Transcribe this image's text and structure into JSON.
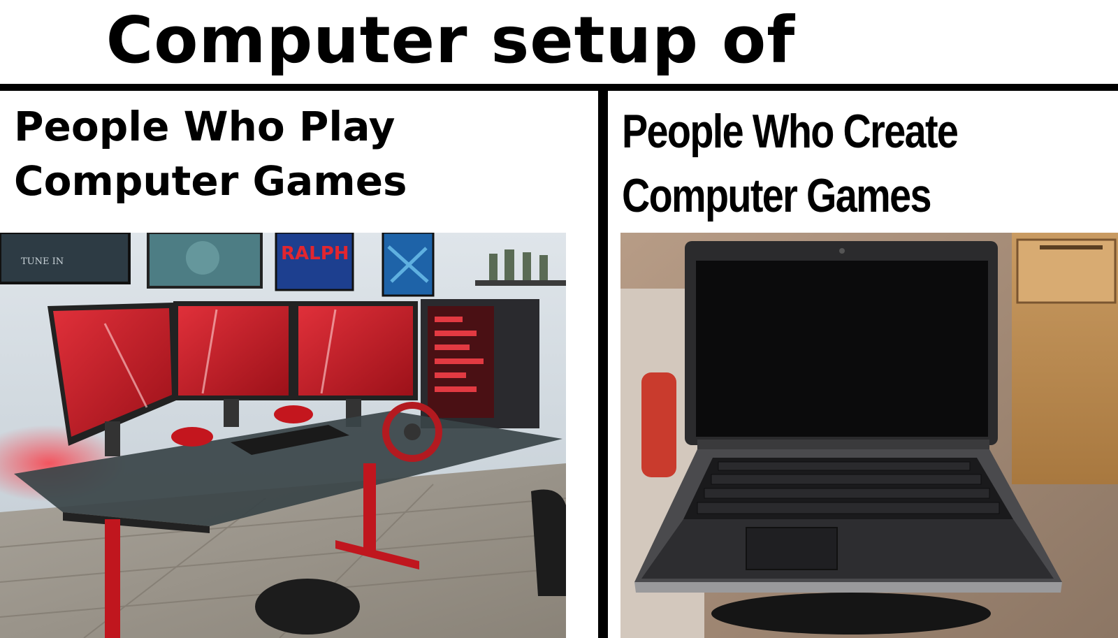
{
  "meme": {
    "title": "Computer setup of",
    "left_caption": {
      "line1": "People Who Play",
      "line2": "Computer Games"
    },
    "right_caption": {
      "line1": "People Who Create",
      "line2": "Computer Games"
    }
  },
  "colors": {
    "accent_red": "#d4212b",
    "divider": "#000000",
    "background": "#ffffff"
  },
  "left_photo": {
    "poster_texts": [
      "TUNE IN",
      "RALPH"
    ]
  },
  "icons": [
    "gaming-setup-photo",
    "laptop-photo"
  ]
}
